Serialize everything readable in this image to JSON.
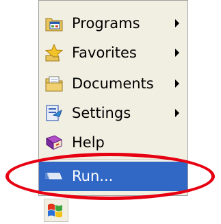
{
  "menu": {
    "items": [
      {
        "label": "Programs",
        "icon": "programs-folder-icon",
        "has_submenu": true
      },
      {
        "label": "Favorites",
        "icon": "favorites-star-icon",
        "has_submenu": true
      },
      {
        "label": "Documents",
        "icon": "documents-folder-icon",
        "has_submenu": true
      },
      {
        "label": "Settings",
        "icon": "settings-control-panel-icon",
        "has_submenu": true
      },
      {
        "label": "Help",
        "icon": "help-book-icon",
        "has_submenu": false
      },
      {
        "label": "Run...",
        "icon": "run-icon",
        "has_submenu": false,
        "selected": true
      }
    ]
  },
  "annotation": {
    "color": "#e60012",
    "shape": "ellipse"
  },
  "colors": {
    "menu_background": "#f1efe2",
    "selection": "#3168c5"
  },
  "taskbar": {
    "start_icon": "windows-flag-icon"
  }
}
